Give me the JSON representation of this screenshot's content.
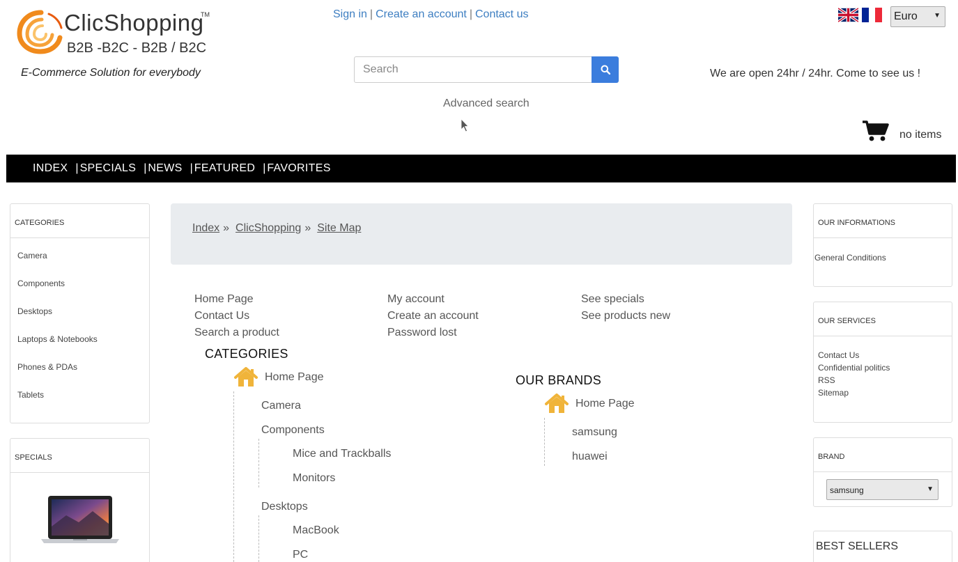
{
  "logo": {
    "brand": "ClicShopping",
    "tm": "TM",
    "tagline": "B2B -B2C - B2B / B2C",
    "slogan": "E-Commerce Solution for everybody"
  },
  "top_links": {
    "sign_in": "Sign in",
    "sep": "|",
    "create_account": "Create an account",
    "contact_us": "Contact us"
  },
  "currency": {
    "selected": "Euro"
  },
  "search": {
    "placeholder": "Search",
    "advanced": "Advanced search"
  },
  "header": {
    "open_message": "We are open 24hr / 24hr. Come to see us !",
    "cart_text": "no items"
  },
  "nav": {
    "separator": "|",
    "items": [
      "INDEX",
      "SPECIALS",
      "NEWS",
      "FEATURED",
      "FAVORITES"
    ]
  },
  "left": {
    "categories": {
      "title": "CATEGORIES",
      "items": [
        "Camera",
        "Components",
        "Desktops",
        "Laptops & Notebooks",
        "Phones & PDAs",
        "Tablets"
      ]
    },
    "specials": {
      "title": "SPECIALS"
    }
  },
  "right": {
    "info": {
      "title": "OUR INFORMATIONS",
      "items": [
        "General Conditions"
      ]
    },
    "services": {
      "title": "OUR SERVICES",
      "items": [
        "Contact Us",
        "Confidential politics",
        "RSS",
        "Sitemap"
      ]
    },
    "brand": {
      "title": "BRAND",
      "selected": "samsung"
    },
    "best_sellers": {
      "title": "BEST SELLERS"
    }
  },
  "breadcrumb": {
    "items": [
      "Index",
      "ClicShopping",
      "Site Map"
    ],
    "sep": "»"
  },
  "sitemap": {
    "col1": [
      "Home Page",
      "Contact Us",
      "Search a product"
    ],
    "col2": [
      "My account",
      "Create an account",
      "Password lost"
    ],
    "col3": [
      "See specials",
      "See products new"
    ],
    "categories_title": "CATEGORIES",
    "categories_home": "Home Page",
    "categories_tree": {
      "camera": "Camera",
      "components": "Components",
      "mice": "Mice and Trackballs",
      "monitors": "Monitors",
      "desktops": "Desktops",
      "macbook": "MacBook",
      "pc": "PC"
    },
    "brands_title": "OUR BRANDS",
    "brands_home": "Home Page",
    "brands": [
      "samsung",
      "huawei"
    ]
  },
  "colors": {
    "accent": "#3b7ddd",
    "nav_bg": "#000000",
    "home_icon": "#f0b43a",
    "logo_orange": "#f08a1c"
  }
}
